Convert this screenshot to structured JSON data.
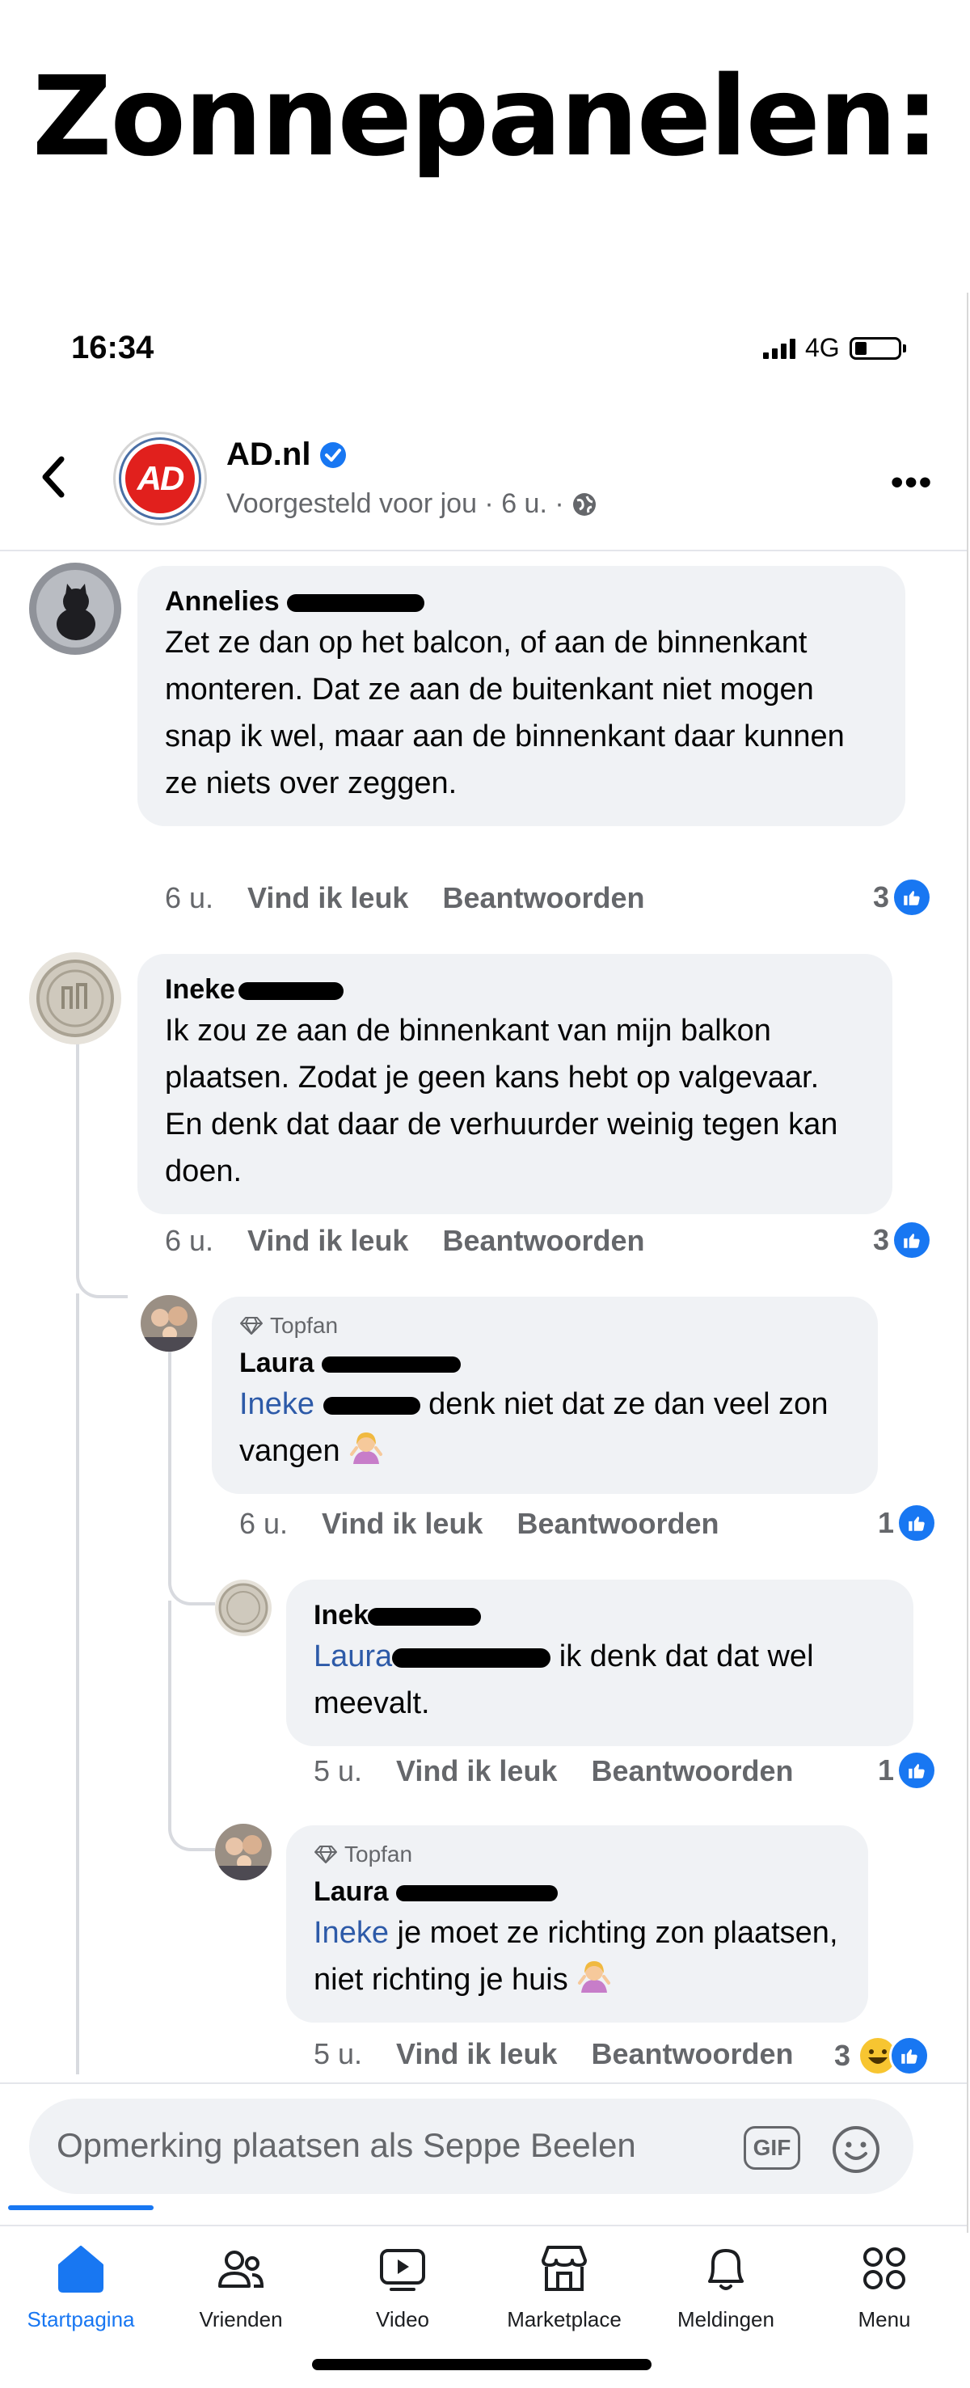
{
  "title": "Zonnepanelen:",
  "status_bar": {
    "time": "16:34",
    "network": "4G"
  },
  "post_header": {
    "page_name": "AD.nl",
    "logo_text": "AD",
    "subtitle": "Voorgesteld voor jou · 6 u. ·"
  },
  "labels": {
    "like": "Vind ik leuk",
    "reply": "Beantwoorden",
    "topfan": "Topfan"
  },
  "comments": [
    {
      "author": "Annelies",
      "text": "Zet ze dan op het balcon, of aan de binnenkant monteren. Dat ze aan de buitenkant niet mogen snap ik wel, maar aan de binnenkant daar kunnen ze niets over zeggen.",
      "time": "6 u.",
      "likes": "3"
    },
    {
      "author": "Ineke",
      "text": "Ik zou ze aan de binnenkant van mijn balkon plaatsen. Zodat je geen kans hebt op valgevaar. En denk dat daar de verhuurder weinig tegen kan doen.",
      "time": "6 u.",
      "likes": "3"
    },
    {
      "author": "Laura",
      "mention": "Ineke",
      "text": "denk niet dat ze dan veel zon vangen",
      "time": "6 u.",
      "likes": "1"
    },
    {
      "author": "Ineke",
      "mention": "Laura",
      "text": "ik denk dat dat wel meevalt.",
      "time": "5 u.",
      "likes": "1"
    },
    {
      "author": "Laura",
      "mention": "Ineke",
      "text": "je moet ze richting zon plaatsen,  niet richting je huis",
      "time": "5 u.",
      "likes": "3"
    }
  ],
  "composer": {
    "placeholder": "Opmerking plaatsen als Seppe Beelen",
    "gif": "GIF"
  },
  "nav": [
    {
      "label": "Startpagina",
      "icon": "home-icon",
      "active": true
    },
    {
      "label": "Vrienden",
      "icon": "friends-icon"
    },
    {
      "label": "Video",
      "icon": "video-icon"
    },
    {
      "label": "Marketplace",
      "icon": "marketplace-icon"
    },
    {
      "label": "Meldingen",
      "icon": "bell-icon"
    },
    {
      "label": "Menu",
      "icon": "menu-grid-icon"
    }
  ],
  "colors": {
    "accent": "#1877f2",
    "bubble": "#f0f2f5",
    "ad_red": "#e1201d"
  }
}
